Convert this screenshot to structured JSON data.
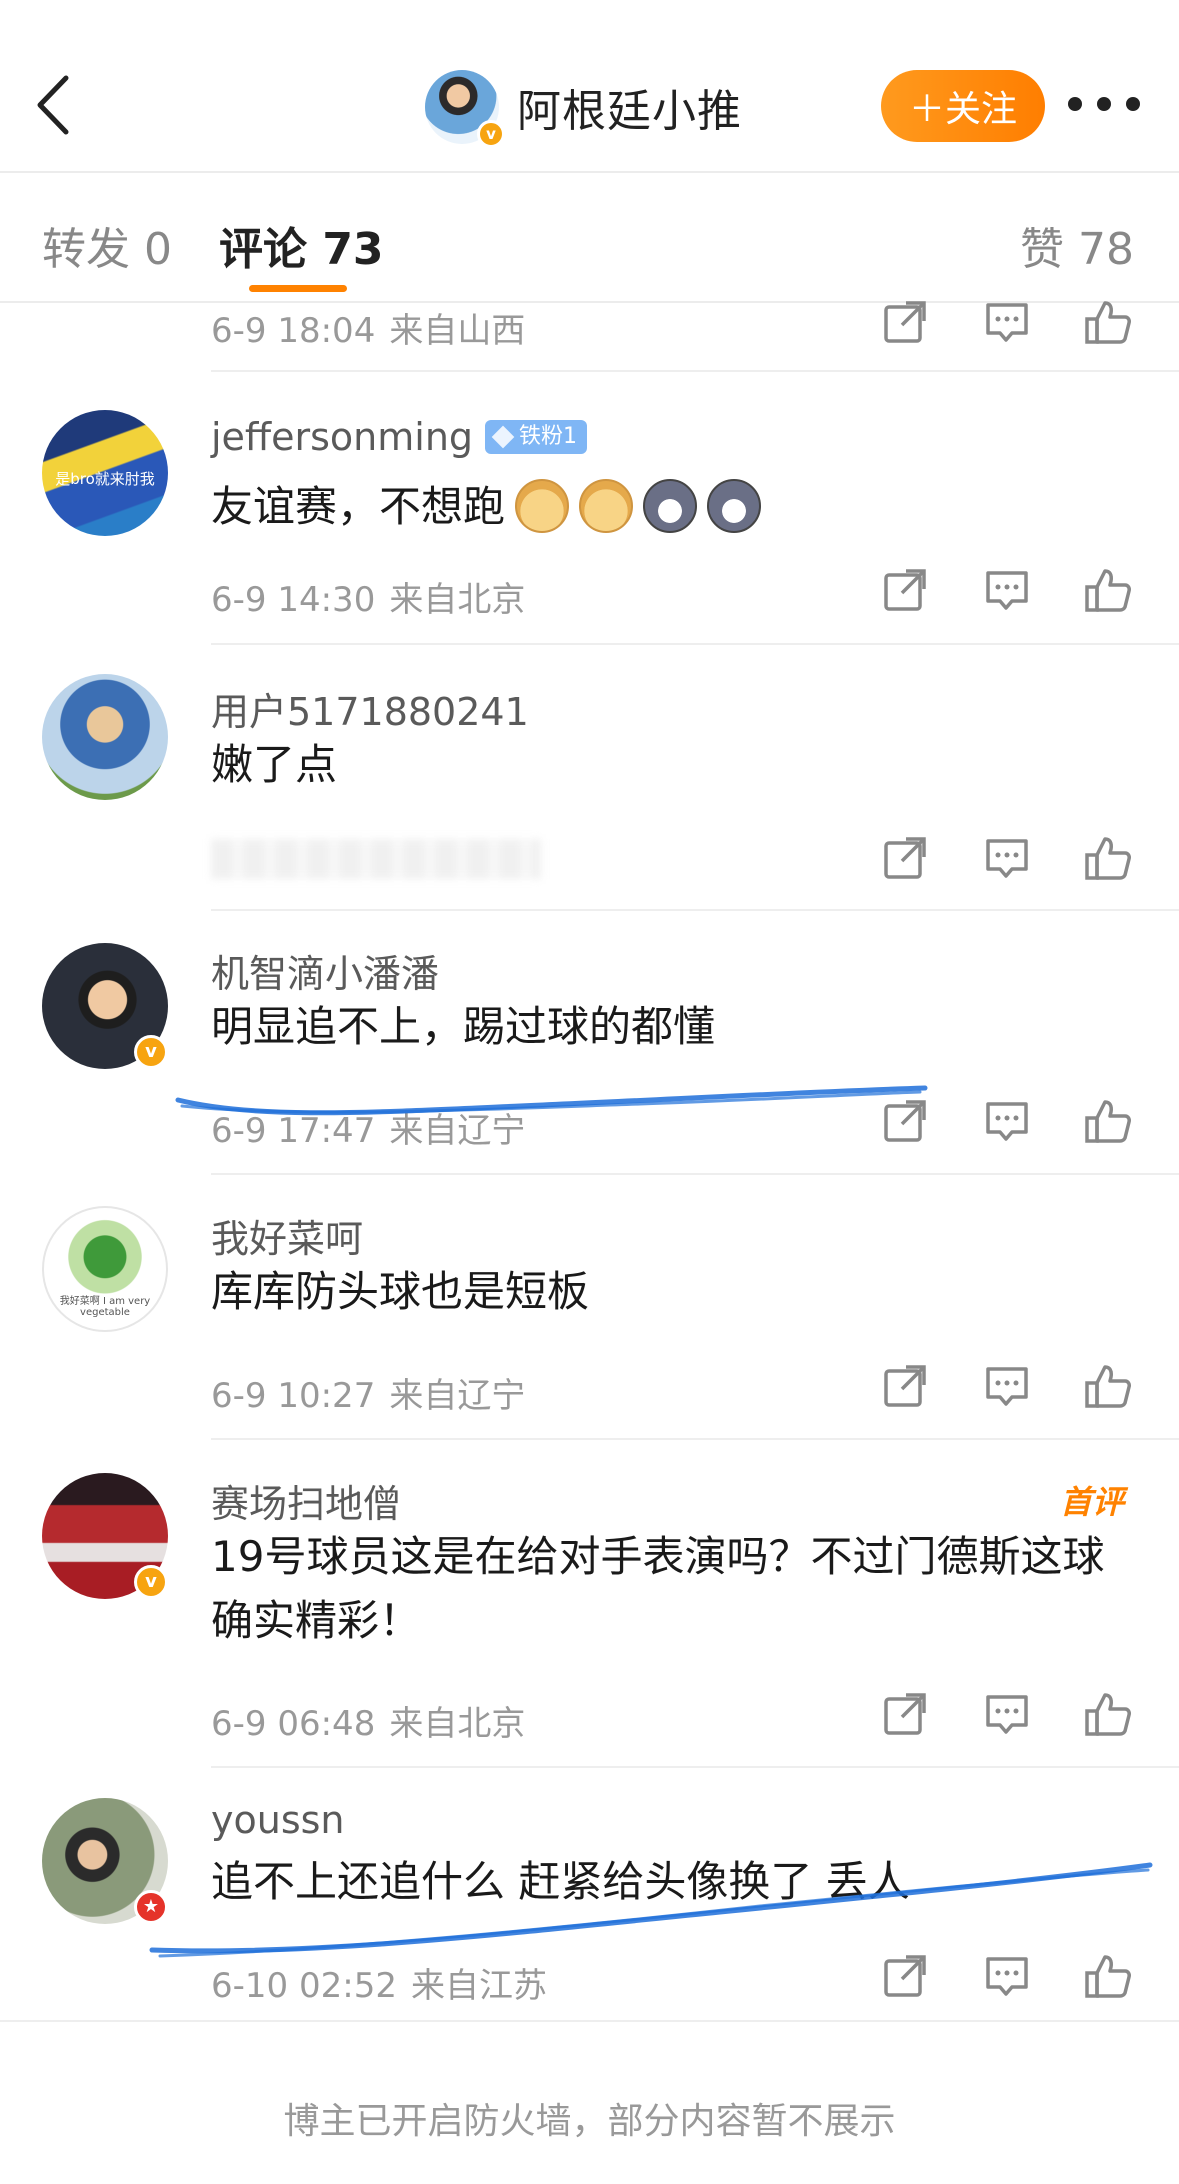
{
  "header": {
    "title": "阿根廷小推",
    "follow_label": "＋关注",
    "back_icon": "chevron-left-icon",
    "more_icon": "more-dots-icon",
    "accent_color": "#ff8200"
  },
  "tabs": {
    "repost": "转发 0",
    "comments": "评论 73",
    "likes": "赞 78"
  },
  "comments": [
    {
      "user": "",
      "text": "",
      "time": "6-9 18:04",
      "location": "来自山西"
    },
    {
      "user": "jeffersonming",
      "fan_badge": "铁粉1",
      "avatar_text": "是bro就来肘我",
      "text": "友谊赛，不想跑",
      "emojis": [
        "doge",
        "doge",
        "husky",
        "husky"
      ],
      "time": "6-9 14:30",
      "location": "来自北京"
    },
    {
      "user": "用户5171880241",
      "text": "嫩了点",
      "time": "",
      "location": ""
    },
    {
      "user": "机智滴小潘潘",
      "text": "明显追不上，踢过球的都懂",
      "verified": true,
      "time": "6-9 17:47",
      "location": "来自辽宁"
    },
    {
      "user": "我好菜呵",
      "avatar_text": "我好菜啊 I am very vegetable",
      "text": "库库防头球也是短板",
      "time": "6-9 10:27",
      "location": "来自辽宁"
    },
    {
      "user": "赛场扫地僧",
      "badge": "首评",
      "verified": true,
      "text": "19号球员这是在给对手表演吗？不过门德斯这球确实精彩！",
      "time": "6-9 06:48",
      "location": "来自北京"
    },
    {
      "user": "youssn",
      "text": "追不上还追什么 赶紧给头像换了 丢人",
      "time": "6-10 02:52",
      "location": "来自江苏"
    }
  ],
  "actions": {
    "repost_icon": "share-icon",
    "comment_icon": "comment-icon",
    "like_icon": "thumbs-up-icon"
  },
  "footer": {
    "text": "博主已开启防火墙，部分内容暂不展示"
  }
}
